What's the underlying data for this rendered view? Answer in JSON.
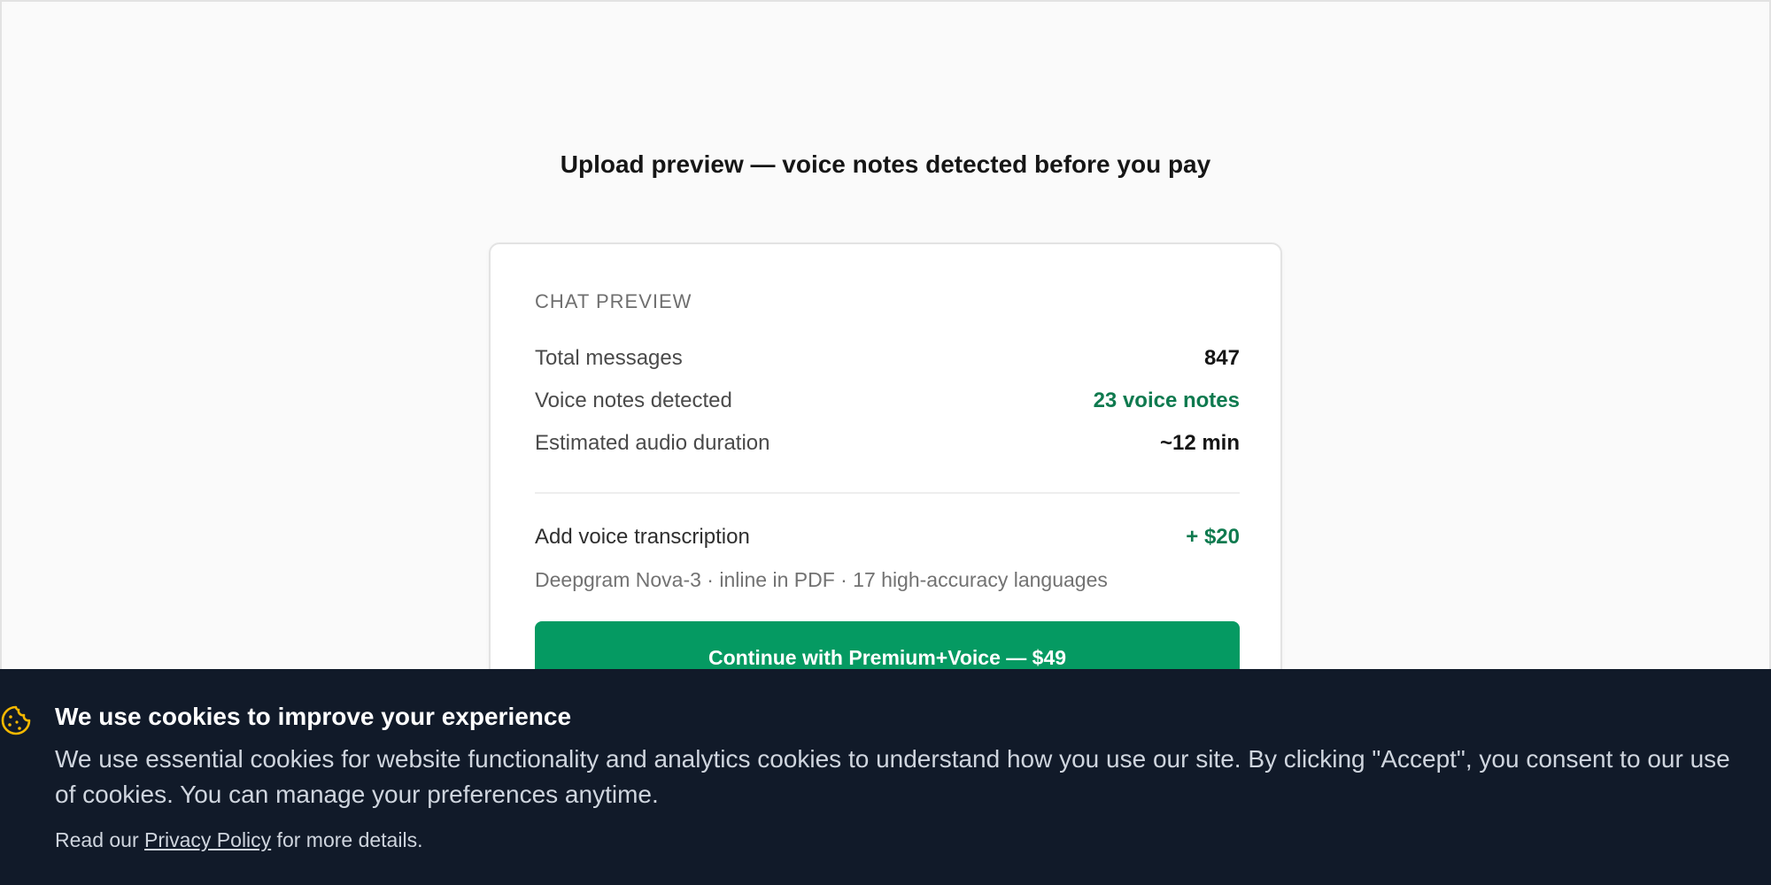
{
  "page": {
    "heading": "Upload preview — voice notes detected before you pay"
  },
  "preview": {
    "section_label": "CHAT PREVIEW",
    "stats": [
      {
        "label": "Total messages",
        "value": "847"
      },
      {
        "label": "Voice notes detected",
        "value": "23 voice notes"
      },
      {
        "label": "Estimated audio duration",
        "value": "~12 min"
      }
    ],
    "addon": {
      "label": "Add voice transcription",
      "price": "+ $20",
      "description": "Deepgram Nova-3 · inline in PDF · 17 high-accuracy languages"
    },
    "cta_label": "Continue with Premium+Voice — $49"
  },
  "cookie": {
    "icon": "cookie-icon",
    "title": "We use cookies to improve your experience",
    "body_line1": "We use essential cookies for website functionality and analytics cookies to understand how you use our site. By clicking \"Accept\", you consent to our use",
    "body_line2": "of cookies. You can manage your preferences anytime.",
    "footer_prefix": "Read our ",
    "footer_link": "Privacy Policy",
    "footer_suffix": " for more details."
  },
  "colors": {
    "accent_green": "#059a62",
    "value_green": "#0f7a4f",
    "banner_bg": "#111a29",
    "cookie_icon": "#f5b800"
  }
}
